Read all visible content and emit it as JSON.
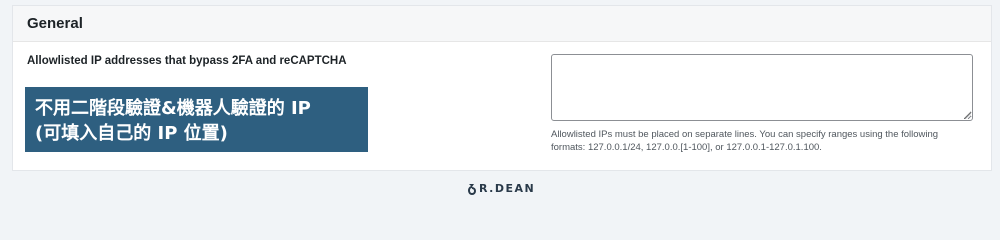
{
  "section": {
    "title": "General"
  },
  "setting": {
    "label": "Allowlisted IP addresses that bypass 2FA and reCAPTCHA",
    "textarea_value": "",
    "help_text": "Allowlisted IPs must be placed on separate lines. You can specify ranges using the following formats: 127.0.0.1/24, 127.0.0.[1-100], or 127.0.0.1-127.0.1.100."
  },
  "annotation": {
    "line1": "不用二階段驗證&機器人驗證的 IP",
    "line2": "(可填入自己的 IP 位置)",
    "background": "#2e5f80"
  },
  "footer": {
    "brand": "R.DEAN",
    "icon": "dr-dean-logo-icon"
  }
}
